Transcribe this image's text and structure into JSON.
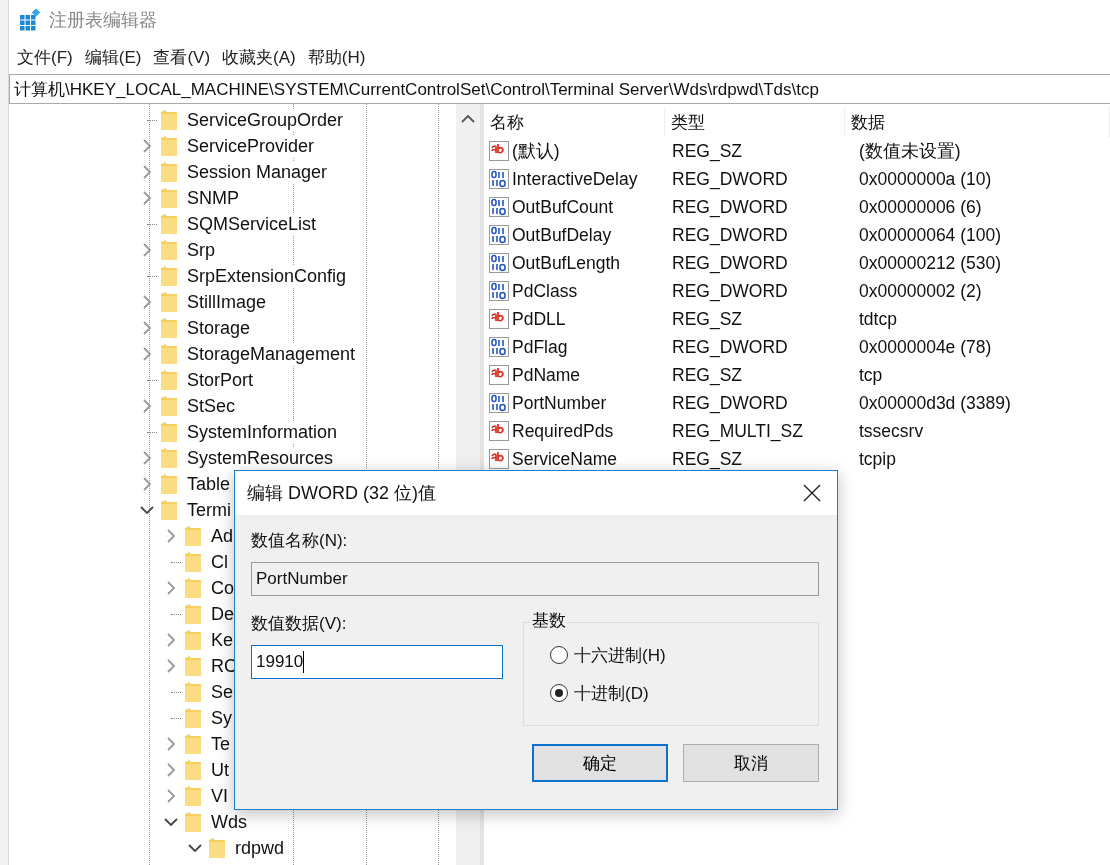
{
  "window": {
    "title": "注册表编辑器"
  },
  "menu": [
    {
      "label": "文件(F)"
    },
    {
      "label": "编辑(E)"
    },
    {
      "label": "查看(V)"
    },
    {
      "label": "收藏夹(A)"
    },
    {
      "label": "帮助(H)"
    }
  ],
  "address": "计算机\\HKEY_LOCAL_MACHINE\\SYSTEM\\CurrentControlSet\\Control\\Terminal Server\\Wds\\rdpwd\\Tds\\tcp",
  "tree": [
    {
      "label": "ServiceGroupOrder",
      "has_children": false
    },
    {
      "label": "ServiceProvider",
      "has_children": true,
      "expanded": false
    },
    {
      "label": "Session Manager",
      "has_children": true,
      "expanded": false
    },
    {
      "label": "SNMP",
      "has_children": true,
      "expanded": false
    },
    {
      "label": "SQMServiceList",
      "has_children": false
    },
    {
      "label": "Srp",
      "has_children": true,
      "expanded": false
    },
    {
      "label": "SrpExtensionConfig",
      "has_children": false
    },
    {
      "label": "StillImage",
      "has_children": true,
      "expanded": false
    },
    {
      "label": "Storage",
      "has_children": true,
      "expanded": false
    },
    {
      "label": "StorageManagement",
      "has_children": true,
      "expanded": false
    },
    {
      "label": "StorPort",
      "has_children": false
    },
    {
      "label": "StSec",
      "has_children": true,
      "expanded": false
    },
    {
      "label": "SystemInformation",
      "has_children": false
    },
    {
      "label": "SystemResources",
      "has_children": true,
      "expanded": false
    },
    {
      "label": "Table",
      "has_children": true,
      "expanded": false
    },
    {
      "label": "Termi",
      "has_children": true,
      "expanded": true,
      "children": [
        {
          "label": "Ad",
          "has_children": true,
          "expanded": false
        },
        {
          "label": "Cl",
          "has_children": false
        },
        {
          "label": "Co",
          "has_children": true,
          "expanded": false
        },
        {
          "label": "De",
          "has_children": false
        },
        {
          "label": "Ke",
          "has_children": true,
          "expanded": false
        },
        {
          "label": "RC",
          "has_children": true,
          "expanded": false
        },
        {
          "label": "Se",
          "has_children": false
        },
        {
          "label": "Sy",
          "has_children": false
        },
        {
          "label": "Te",
          "has_children": true,
          "expanded": false
        },
        {
          "label": "Ut",
          "has_children": true,
          "expanded": false
        },
        {
          "label": "VI",
          "has_children": true,
          "expanded": false
        },
        {
          "label": "Wds",
          "has_children": true,
          "expanded": true,
          "children": [
            {
              "label": "rdpwd",
              "has_children": true,
              "expanded": true
            }
          ]
        }
      ]
    }
  ],
  "list": {
    "columns": [
      "名称",
      "类型",
      "数据"
    ],
    "rows": [
      {
        "kind": "string",
        "name": "(默认)",
        "type": "REG_SZ",
        "data": "(数值未设置)"
      },
      {
        "kind": "binary",
        "name": "InteractiveDelay",
        "type": "REG_DWORD",
        "data": "0x0000000a (10)"
      },
      {
        "kind": "binary",
        "name": "OutBufCount",
        "type": "REG_DWORD",
        "data": "0x00000006 (6)"
      },
      {
        "kind": "binary",
        "name": "OutBufDelay",
        "type": "REG_DWORD",
        "data": "0x00000064 (100)"
      },
      {
        "kind": "binary",
        "name": "OutBufLength",
        "type": "REG_DWORD",
        "data": "0x00000212 (530)"
      },
      {
        "kind": "binary",
        "name": "PdClass",
        "type": "REG_DWORD",
        "data": "0x00000002 (2)"
      },
      {
        "kind": "string",
        "name": "PdDLL",
        "type": "REG_SZ",
        "data": "tdtcp"
      },
      {
        "kind": "binary",
        "name": "PdFlag",
        "type": "REG_DWORD",
        "data": "0x0000004e (78)"
      },
      {
        "kind": "string",
        "name": "PdName",
        "type": "REG_SZ",
        "data": "tcp"
      },
      {
        "kind": "binary",
        "name": "PortNumber",
        "type": "REG_DWORD",
        "data": "0x00000d3d (3389)"
      },
      {
        "kind": "string",
        "name": "RequiredPds",
        "type": "REG_MULTI_SZ",
        "data": "tssecsrv"
      },
      {
        "kind": "string",
        "name": "ServiceName",
        "type": "REG_SZ",
        "data": "tcpip"
      }
    ]
  },
  "dialog": {
    "title": "编辑 DWORD (32 位)值",
    "name_label": "数值名称(N):",
    "name_value": "PortNumber",
    "data_label": "数值数据(V):",
    "data_value": "19910",
    "base_label": "基数",
    "radios": [
      {
        "label": "十六进制(H)",
        "selected": false
      },
      {
        "label": "十进制(D)",
        "selected": true
      }
    ],
    "buttons": [
      {
        "label": "确定",
        "default": true
      },
      {
        "label": "取消",
        "default": false
      }
    ]
  }
}
